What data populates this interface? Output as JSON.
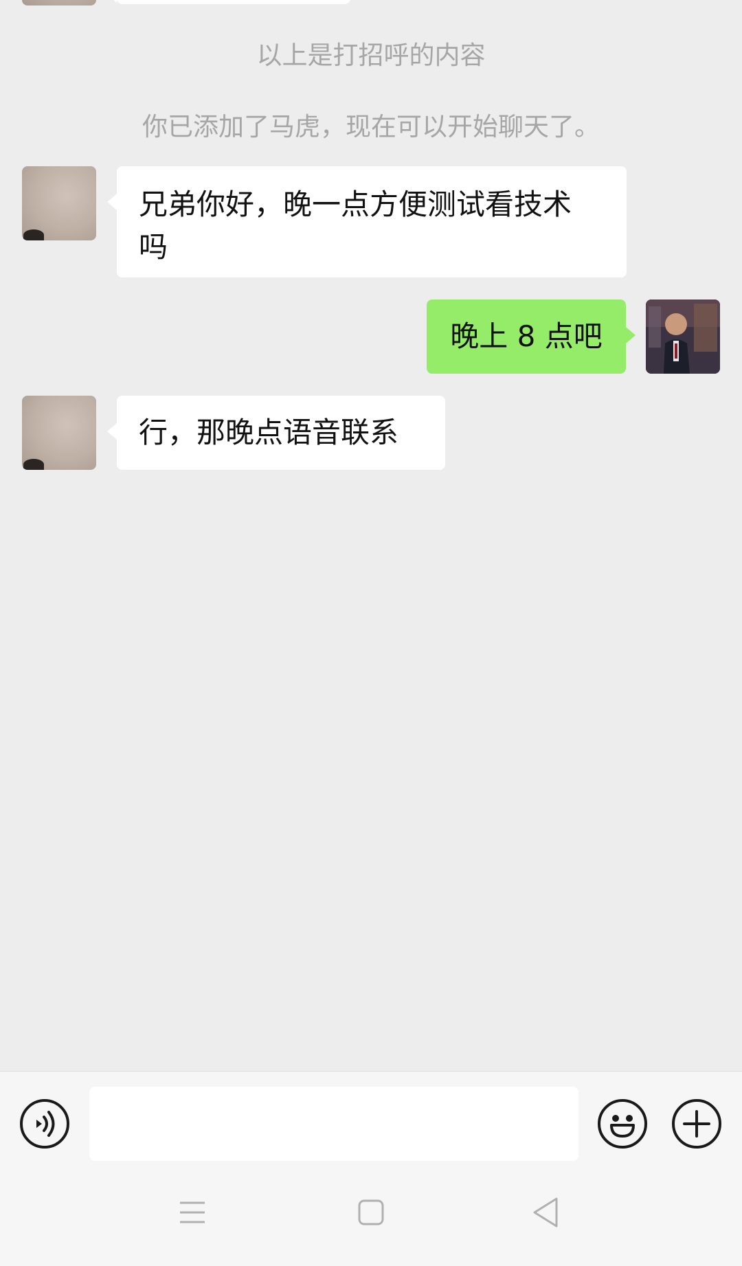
{
  "system_messages": {
    "greeting_note": "以上是打招呼的内容",
    "added_note": "你已添加了马虎，现在可以开始聊天了。"
  },
  "messages": [
    {
      "side": "left",
      "line1": "兄弟你好，晚一点方便测试看技术",
      "line2": "吗"
    },
    {
      "side": "right",
      "text": "晚上 8 点吧"
    },
    {
      "side": "left",
      "text": "行，那晚点语音联系"
    }
  ],
  "input": {
    "value": "",
    "placeholder": ""
  },
  "icons": {
    "voice": "voice-icon",
    "emoji": "emoji-icon",
    "add": "plus-icon",
    "menu": "menu-icon",
    "home": "home-icon",
    "back": "back-icon"
  },
  "colors": {
    "background": "#ededed",
    "bubble_other": "#ffffff",
    "bubble_self": "#95ec69",
    "system_text": "#a6a6a6"
  }
}
